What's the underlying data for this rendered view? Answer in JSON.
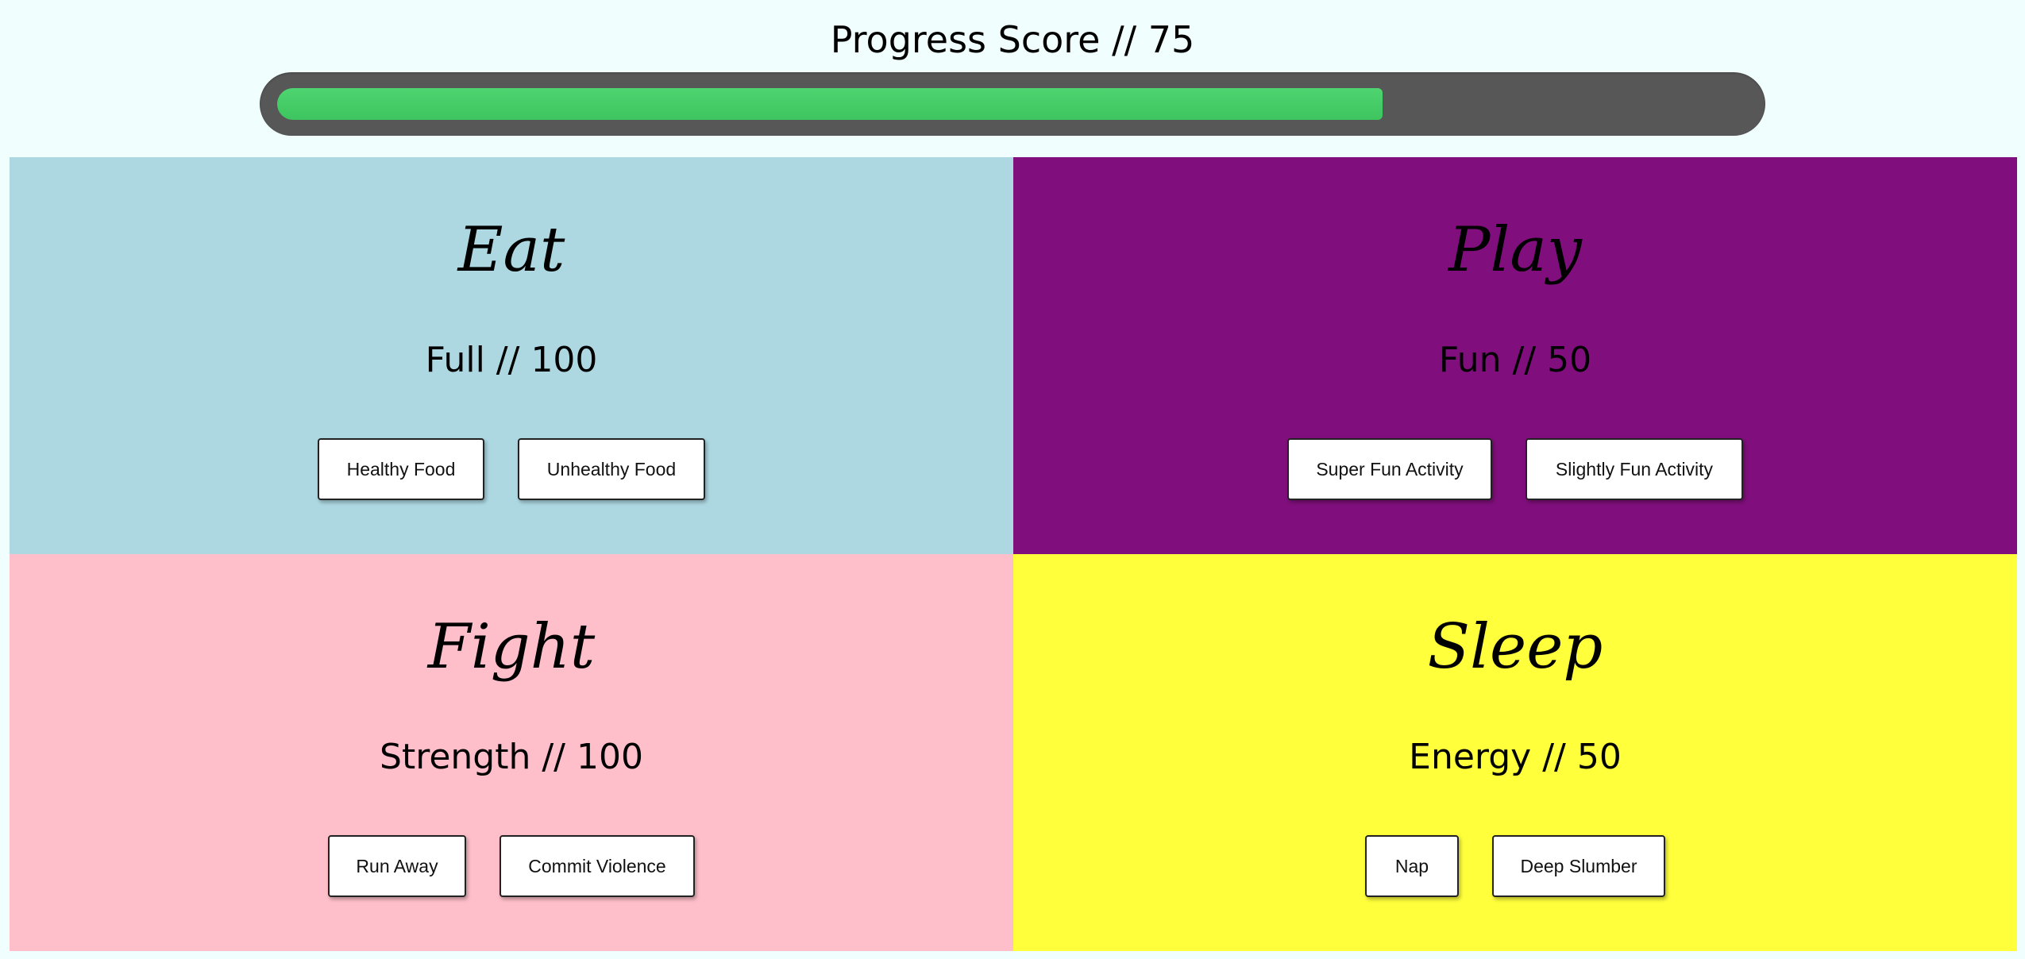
{
  "progress": {
    "title": "Progress Score // 75",
    "value_percent": 75,
    "fill_color": "#3ec55f",
    "track_color": "#575757"
  },
  "panels": {
    "eat": {
      "title": "Eat",
      "stat": "Full // 100",
      "bg_color": "#add8e2",
      "buttons": [
        "Healthy Food",
        "Unhealthy Food"
      ]
    },
    "play": {
      "title": "Play",
      "stat": "Fun // 50",
      "bg_color": "#800f7d",
      "buttons": [
        "Super Fun Activity",
        "Slightly Fun Activity"
      ]
    },
    "fight": {
      "title": "Fight",
      "stat": "Strength // 100",
      "bg_color": "#ffbfca",
      "buttons": [
        "Run Away",
        "Commit Violence"
      ]
    },
    "sleep": {
      "title": "Sleep",
      "stat": "Energy // 50",
      "bg_color": "#ffff3c",
      "buttons": [
        "Nap",
        "Deep Slumber"
      ]
    }
  }
}
